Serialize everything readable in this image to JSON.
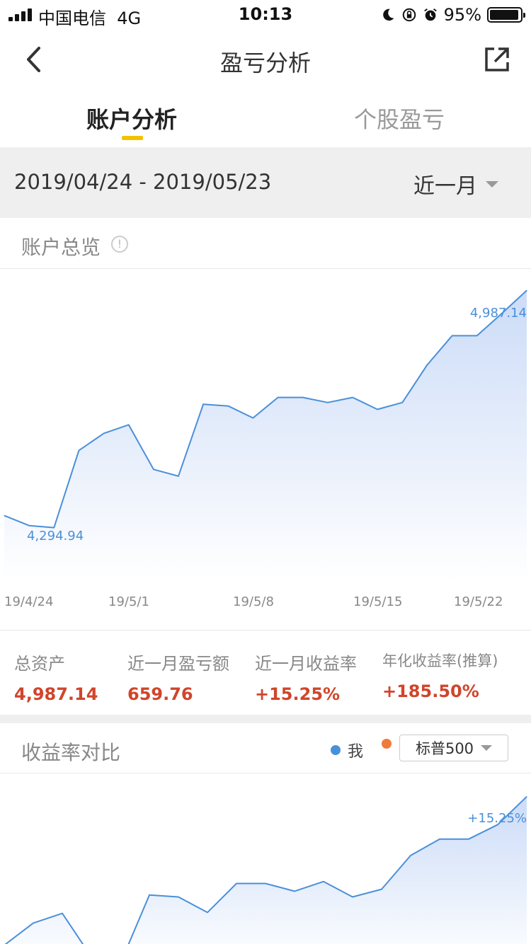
{
  "status_bar": {
    "carrier": "中国电信",
    "network": "4G",
    "time": "10:13",
    "battery": "95%",
    "icons": [
      "signal-icon",
      "moon-icon",
      "rotation-lock-icon",
      "alarm-icon",
      "battery-icon"
    ]
  },
  "nav": {
    "title": "盈亏分析",
    "back_icon": "chevron-left-icon",
    "share_icon": "share-icon"
  },
  "tabs": [
    {
      "label": "账户分析",
      "active": true
    },
    {
      "label": "个股盈亏",
      "active": false
    }
  ],
  "accent_color": "#f2c200",
  "date_bar": {
    "range": "2019/04/24 - 2019/05/23",
    "period": "近一月"
  },
  "overview": {
    "title": "账户总览",
    "max_label": "4,987.14",
    "min_label": "4,294.94"
  },
  "stats": [
    {
      "label": "总资产",
      "value": "4,987.14"
    },
    {
      "label": "近一月盈亏额",
      "value": "659.76"
    },
    {
      "label": "近一月收益率",
      "value": "+15.25%"
    },
    {
      "label": "年化收益率(推算)",
      "value": "+185.50%"
    }
  ],
  "comparison": {
    "title": "收益率对比",
    "legend": [
      {
        "label": "我",
        "color": "#4a90d9"
      },
      {
        "label": "",
        "color": "#f07a3a"
      }
    ],
    "benchmark": "标普500",
    "max_label": "+15.25%"
  },
  "chart_data": [
    {
      "type": "area",
      "x_ticks": [
        "19/4/24",
        "19/5/1",
        "19/5/8",
        "19/5/15",
        "19/5/22"
      ],
      "values": [
        4330,
        4301,
        4295,
        4520,
        4570,
        4595,
        4465,
        4445,
        4655,
        4650,
        4615,
        4675,
        4675,
        4660,
        4675,
        4640,
        4660,
        4770,
        4855,
        4855,
        4920,
        4987.14
      ],
      "ylim": [
        4100,
        5050
      ],
      "annotations": [
        "4,987.14",
        "4,294.94"
      ],
      "line_color": "#4a90d9"
    },
    {
      "type": "area",
      "values": [
        4.2,
        6.5,
        7.5,
        3.0,
        2.3,
        9.4,
        9.2,
        7.6,
        10.6,
        10.6,
        9.8,
        10.8,
        9.2,
        10.0,
        13.5,
        15.2,
        15.2,
        16.7,
        19.6
      ],
      "ylim": [
        0,
        22
      ],
      "annotations": [
        "+15.25%"
      ],
      "line_color": "#4a90d9"
    }
  ]
}
